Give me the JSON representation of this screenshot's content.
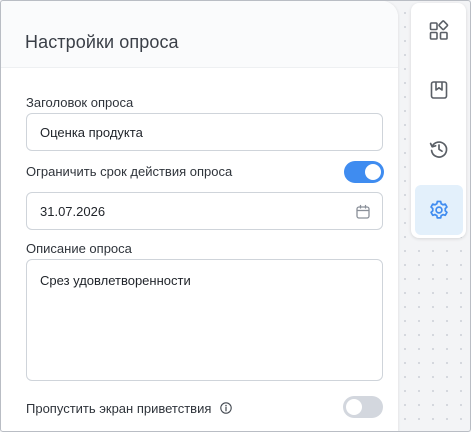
{
  "panel": {
    "title": "Настройки опроса",
    "survey_title_label": "Заголовок опроса",
    "survey_title_value": "Оценка продукта",
    "limit_label": "Ограничить срок действия опроса",
    "limit_enabled": true,
    "date_value": "31.07.2026",
    "description_label": "Описание опроса",
    "description_value": "Срез удовлетворенности",
    "skip_welcome_label": "Пропустить экран приветствия",
    "skip_welcome_enabled": false
  },
  "rail": {
    "items": [
      {
        "icon": "widgets-icon",
        "active": false
      },
      {
        "icon": "bookmark-icon",
        "active": false
      },
      {
        "icon": "history-icon",
        "active": false
      },
      {
        "icon": "gear-icon",
        "active": true
      }
    ]
  },
  "colors": {
    "accent": "#3f8cf0",
    "active_bg": "#e3f0fb",
    "icon": "#5a5f66"
  }
}
